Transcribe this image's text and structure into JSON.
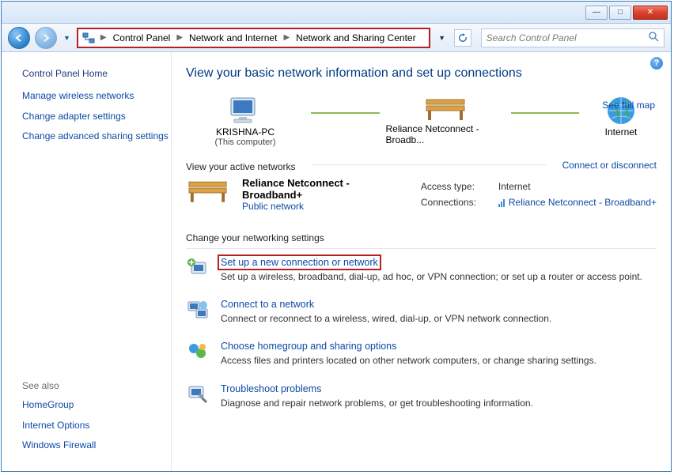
{
  "toolbar": {
    "breadcrumb": [
      "Control Panel",
      "Network and Internet",
      "Network and Sharing Center"
    ],
    "search_placeholder": "Search Control Panel"
  },
  "sidebar": {
    "home": "Control Panel Home",
    "links": [
      "Manage wireless networks",
      "Change adapter settings",
      "Change advanced sharing settings"
    ],
    "seealso_label": "See also",
    "seealso": [
      "HomeGroup",
      "Internet Options",
      "Windows Firewall"
    ]
  },
  "main": {
    "title": "View your basic network information and set up connections",
    "see_full_map": "See full map",
    "map": {
      "pc_name": "KRISHNA-PC",
      "pc_sub": "(This computer)",
      "gateway": "Reliance Netconnect - Broadb...",
      "internet": "Internet"
    },
    "active_label": "View your active networks",
    "connect_disconnect": "Connect or disconnect",
    "active": {
      "name": "Reliance Netconnect - Broadband+",
      "type": "Public network",
      "access_label": "Access type:",
      "access_value": "Internet",
      "conn_label": "Connections:",
      "conn_value": "Reliance Netconnect - Broadband+"
    },
    "settings_label": "Change your networking settings",
    "tasks": [
      {
        "title": "Set up a new connection or network",
        "desc": "Set up a wireless, broadband, dial-up, ad hoc, or VPN connection; or set up a router or access point."
      },
      {
        "title": "Connect to a network",
        "desc": "Connect or reconnect to a wireless, wired, dial-up, or VPN network connection."
      },
      {
        "title": "Choose homegroup and sharing options",
        "desc": "Access files and printers located on other network computers, or change sharing settings."
      },
      {
        "title": "Troubleshoot problems",
        "desc": "Diagnose and repair network problems, or get troubleshooting information."
      }
    ]
  }
}
